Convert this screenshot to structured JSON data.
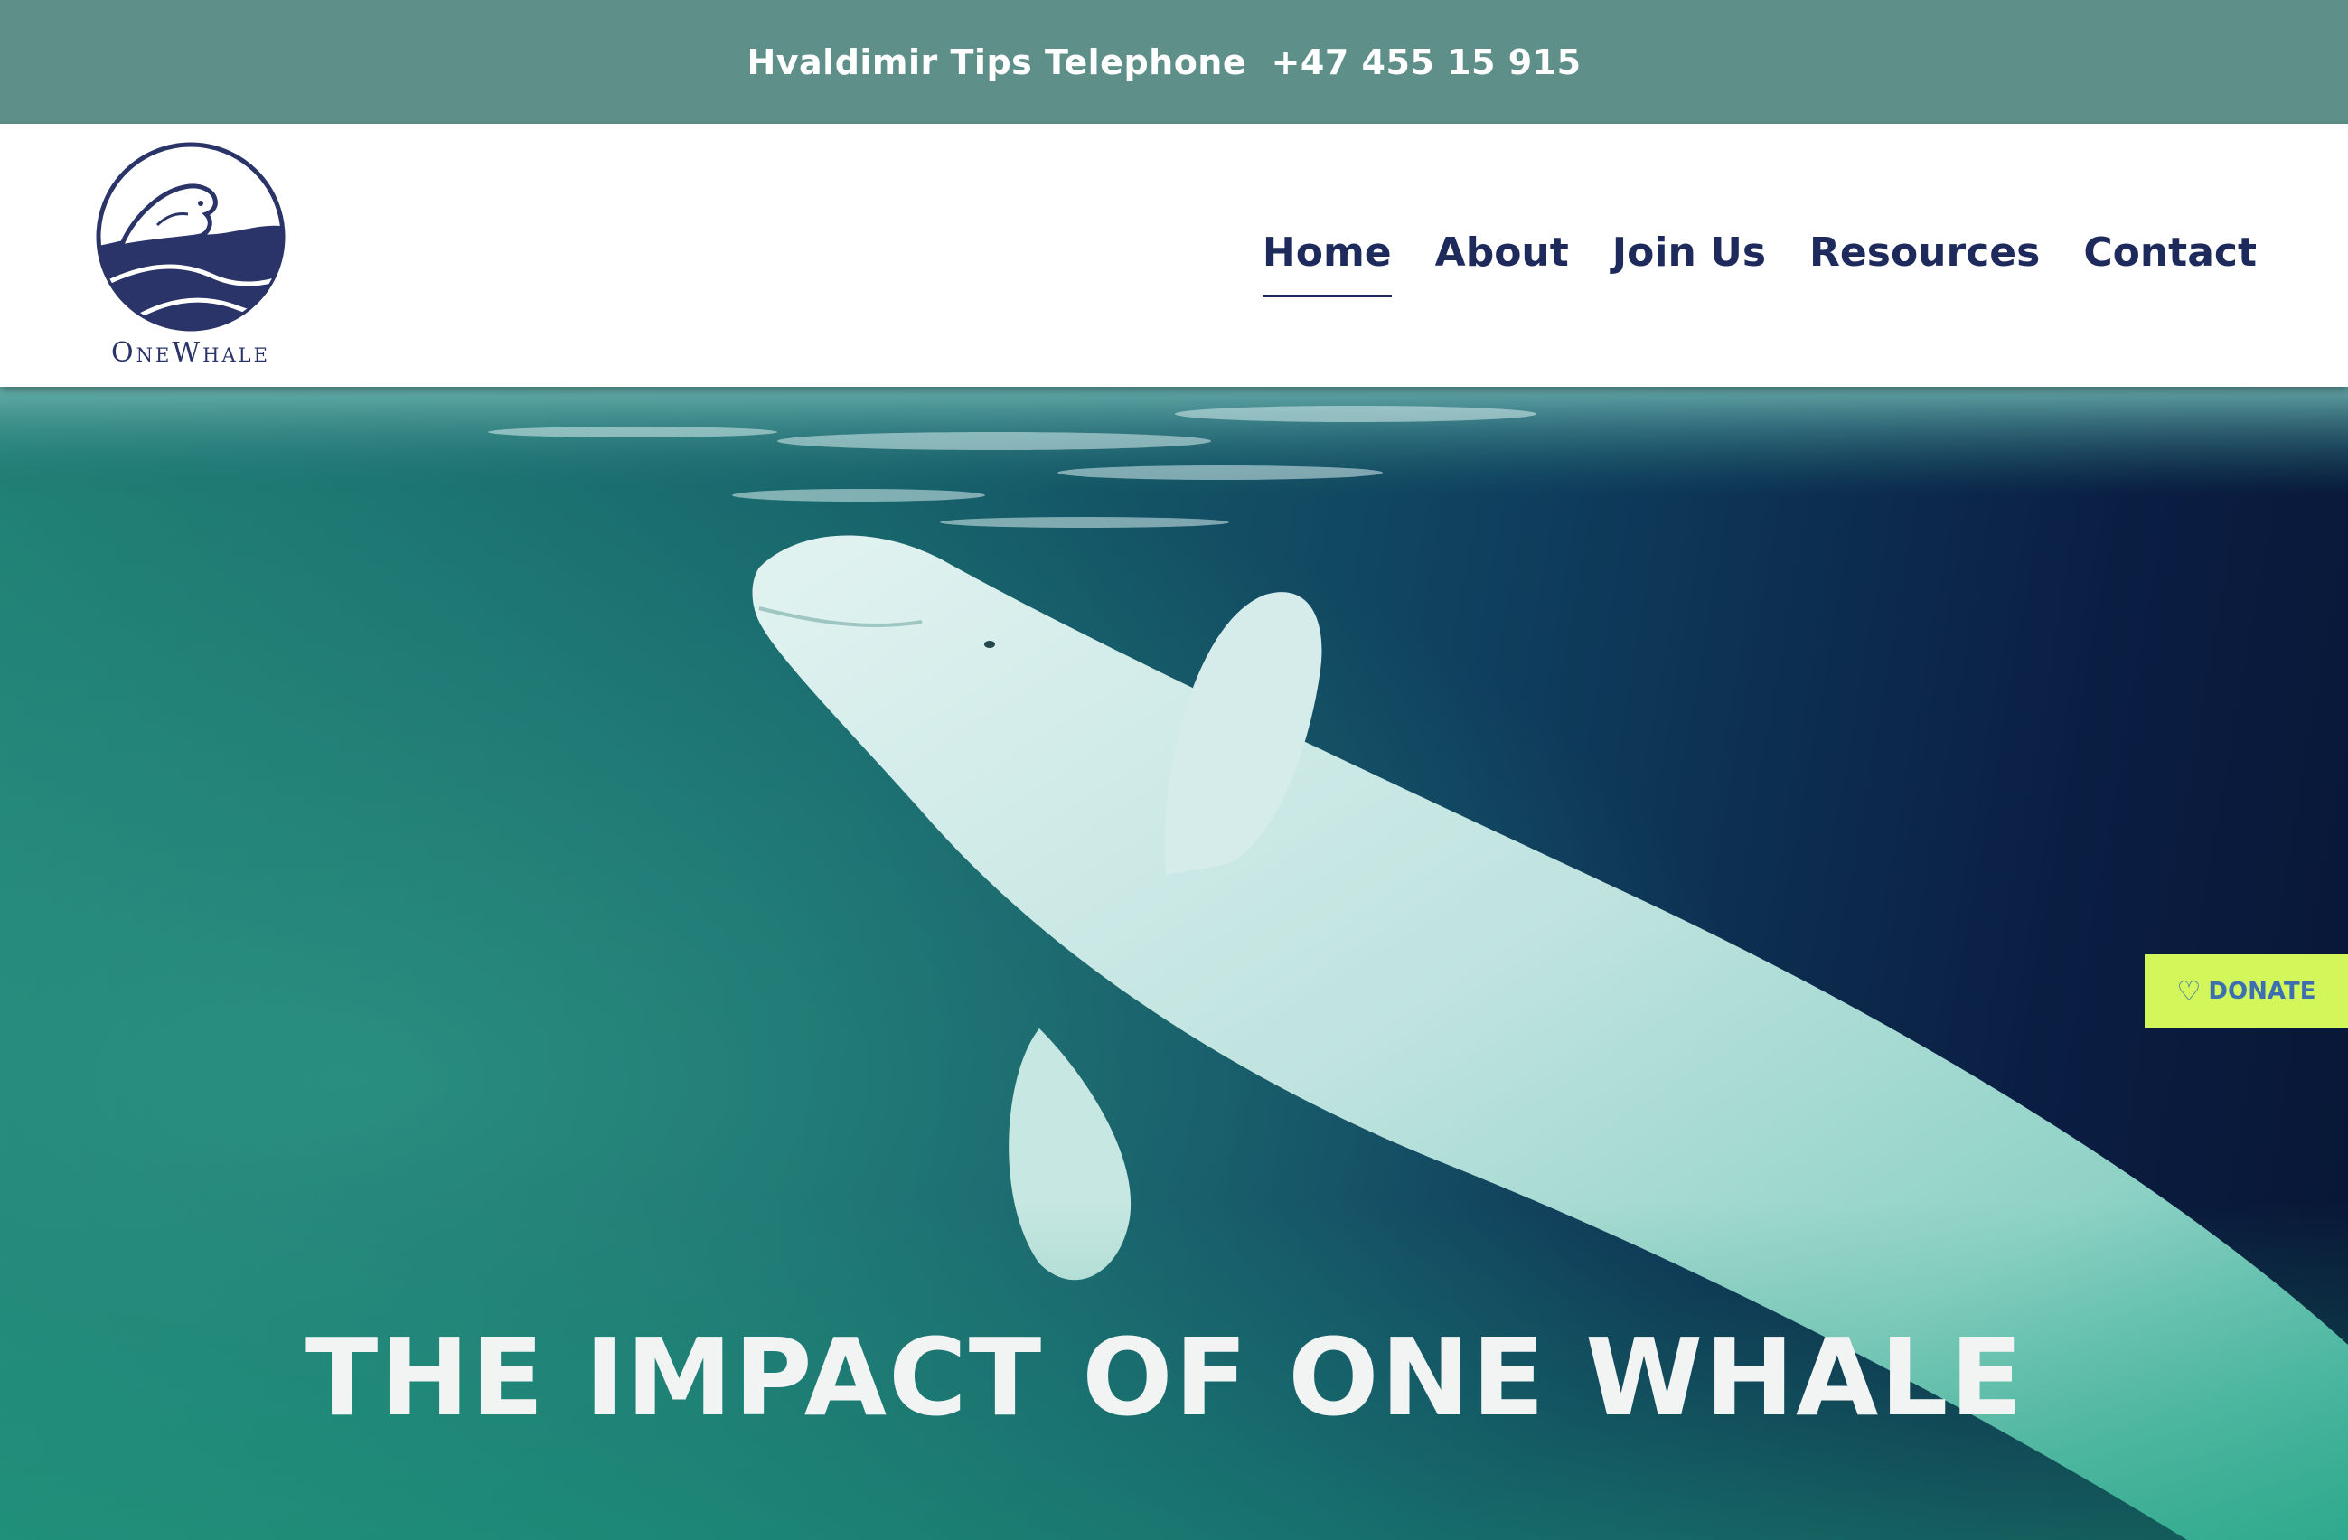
{
  "topbar": {
    "tips_text": "Hvaldimir Tips Telephone  +47 455 15 915"
  },
  "header": {
    "logo_text": "OneWhale",
    "logo_icon": "beluga-logo-icon"
  },
  "nav": {
    "items": [
      {
        "label": "Home",
        "active": true
      },
      {
        "label": "About",
        "active": false
      },
      {
        "label": "Join Us",
        "active": false
      },
      {
        "label": "Resources",
        "active": false
      },
      {
        "label": "Contact",
        "active": false
      }
    ]
  },
  "hero": {
    "title": "THE IMPACT OF ONE WHALE"
  },
  "donate": {
    "label": "DONATE",
    "icon": "heart-icon"
  },
  "colors": {
    "topbar_bg": "#5e8f89",
    "nav_text": "#1f2a5c",
    "donate_bg": "#d3f75a",
    "donate_text": "#3d6fb0"
  }
}
